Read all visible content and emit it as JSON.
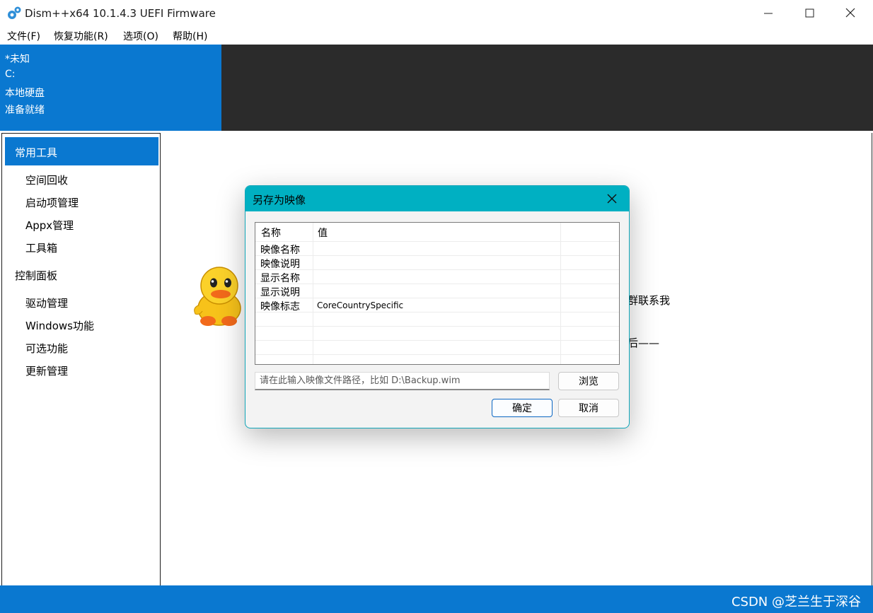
{
  "window": {
    "title": "Dism++x64 10.1.4.3 UEFI Firmware",
    "icons": [
      "gear-icon",
      "minimize-icon",
      "maximize-icon",
      "close-icon"
    ]
  },
  "menu": [
    "文件(F)",
    "恢复功能(R)",
    "选项(O)",
    "帮助(H)"
  ],
  "info": {
    "lines": [
      "*未知",
      "C:",
      "本地硬盘",
      "准备就绪"
    ]
  },
  "sidebar": {
    "main": "常用工具",
    "group1": [
      "空间回收",
      "启动项管理",
      "Appx管理",
      "工具箱"
    ],
    "group2_header": "控制面板",
    "group2": [
      "驱动管理",
      "Windows功能",
      "可选功能",
      "更新管理"
    ]
  },
  "background_text": {
    "line1": "群联系我",
    "line2": "后——"
  },
  "dialog": {
    "title": "另存为映像",
    "columns": [
      "名称",
      "值"
    ],
    "rows": [
      {
        "name": "映像名称",
        "value": ""
      },
      {
        "name": "映像说明",
        "value": ""
      },
      {
        "name": "显示名称",
        "value": ""
      },
      {
        "name": "显示说明",
        "value": ""
      },
      {
        "name": "映像标志",
        "value": "CoreCountrySpecific"
      }
    ],
    "path_placeholder": "请在此输入映像文件路径，比如 D:\\Backup.wim",
    "browse_label": "浏览",
    "ok_label": "确定",
    "cancel_label": "取消"
  },
  "colors": {
    "accent": "#0a78d0",
    "dialog_title": "#00b0c2",
    "dark_panel": "#2b2b2b"
  },
  "watermark": "CSDN @芝兰生于深谷"
}
